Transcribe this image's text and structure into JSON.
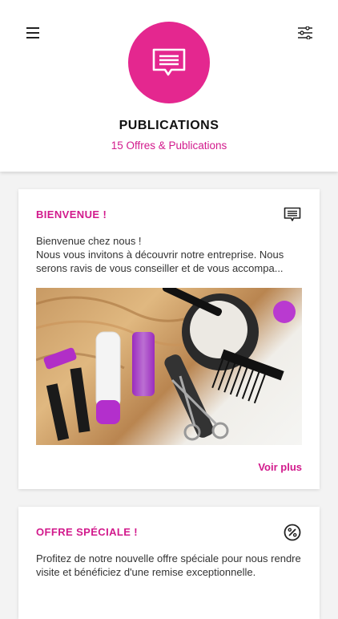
{
  "header": {
    "title": "PUBLICATIONS",
    "subtitle": "15 Offres & Publications",
    "menu_icon": "menu-icon",
    "filter_icon": "filter-icon",
    "avatar_icon": "message-icon"
  },
  "colors": {
    "accent": "#d21a8c",
    "avatar_bg": "#e4278f",
    "background": "#f3f3f3"
  },
  "cards": [
    {
      "title": "BIENVENUE !",
      "icon": "message-icon",
      "lines": [
        "Bienvenue chez nous !",
        "Nous vous invitons à découvrir notre entreprise. Nous",
        "serons ravis de vous conseiller et de vous accompa..."
      ],
      "image": "hairdresser-tools-image",
      "see_more": "Voir plus"
    },
    {
      "title": "OFFRE SPÉCIALE !",
      "icon": "discount-icon",
      "text": "Profitez de notre nouvelle offre spéciale pour nous rendre visite et bénéficiez d'une remise exceptionnelle."
    }
  ]
}
